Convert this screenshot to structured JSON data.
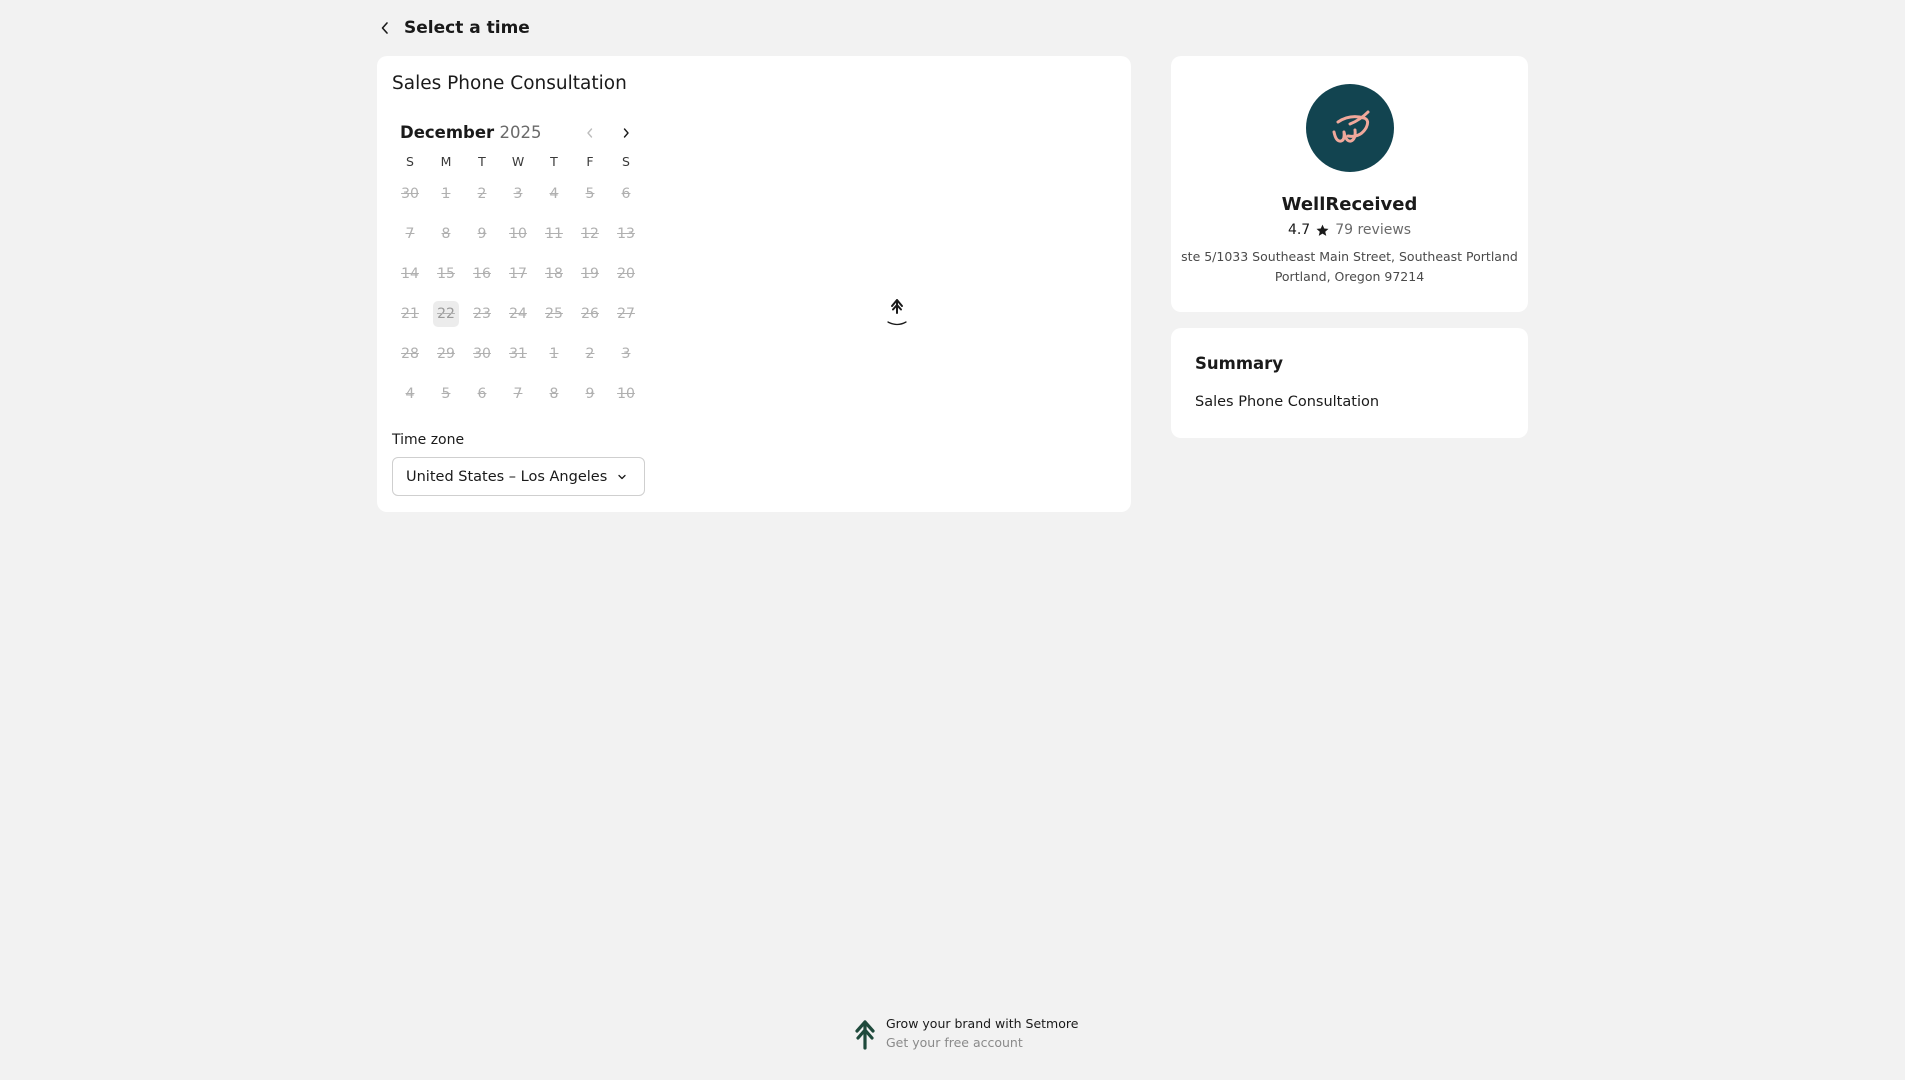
{
  "header": {
    "title": "Select a time",
    "back_icon": "chevron-left-icon"
  },
  "service": {
    "title": "Sales Phone Consultation"
  },
  "calendar": {
    "month": "December",
    "year": "2025",
    "weekdays": [
      "S",
      "M",
      "T",
      "W",
      "T",
      "F",
      "S"
    ],
    "days": [
      "30",
      "1",
      "2",
      "3",
      "4",
      "5",
      "6",
      "7",
      "8",
      "9",
      "10",
      "11",
      "12",
      "13",
      "14",
      "15",
      "16",
      "17",
      "18",
      "19",
      "20",
      "21",
      "22",
      "23",
      "24",
      "25",
      "26",
      "27",
      "28",
      "29",
      "30",
      "31",
      "1",
      "2",
      "3",
      "4",
      "5",
      "6",
      "7",
      "8",
      "9",
      "10"
    ],
    "today": "22",
    "all_days_unavailable": true
  },
  "timezone": {
    "label": "Time zone",
    "value": "United States – Los Angeles"
  },
  "business": {
    "name": "WellReceived",
    "rating": "4.7",
    "reviews": "79 reviews",
    "address_line1": "ste 5/1033 Southeast Main Street, Southeast Portland",
    "address_line2": "Portland, Oregon 97214",
    "avatar_color": "#124450",
    "logo_color": "#f0a89b"
  },
  "summary": {
    "title": "Summary",
    "item": "Sales Phone Consultation"
  },
  "footer": {
    "line1": "Grow your brand with Setmore",
    "line2": "Get your free account"
  },
  "colors": {
    "background": "#f2f2f2",
    "card": "#ffffff",
    "brand_dark": "#124450",
    "setmore_green": "#1f4a3c"
  }
}
